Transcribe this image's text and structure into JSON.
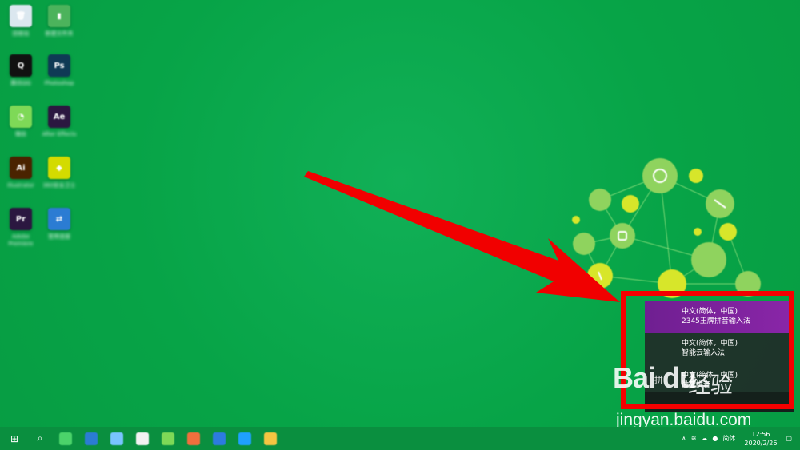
{
  "desktop": {
    "background": "#0aa64a",
    "icons": [
      {
        "name": "Recycle Bin",
        "label": "回收站",
        "icon": "recycle-bin-icon",
        "color": "#dbe7ef",
        "glyph": "🗑"
      },
      {
        "name": "Folder",
        "label": "新建文件夹",
        "icon": "folder-icon",
        "color": "#4cb35c",
        "glyph": "▮"
      },
      {
        "name": "QQ",
        "label": "腾讯QQ",
        "icon": "qq-icon",
        "color": "#111111",
        "glyph": "Q"
      },
      {
        "name": "Photoshop",
        "label": "Photoshop",
        "icon": "photoshop-icon",
        "color": "#0f3a55",
        "glyph": "Ps"
      },
      {
        "name": "WeChat",
        "label": "微信",
        "icon": "wechat-icon",
        "color": "#7ed957",
        "glyph": "◔"
      },
      {
        "name": "After Effects",
        "label": "After Effects",
        "icon": "after-effects-icon",
        "color": "#2b1740",
        "glyph": "Ae"
      },
      {
        "name": "Illustrator",
        "label": "Illustrator",
        "icon": "illustrator-icon",
        "color": "#4a2300",
        "glyph": "Ai"
      },
      {
        "name": "Security Guard",
        "label": "360安全卫士",
        "icon": "security-icon",
        "color": "#d3db00",
        "glyph": "◆"
      },
      {
        "name": "Premiere",
        "label": "Adobe Premiere",
        "icon": "premiere-icon",
        "color": "#2b1740",
        "glyph": "Pr"
      },
      {
        "name": "Network",
        "label": "宽带连接",
        "icon": "network-icon",
        "color": "#2b7cd3",
        "glyph": "⇄"
      }
    ]
  },
  "input_menu": {
    "items": [
      {
        "lang": "中文(简体，中国)",
        "method": "2345王牌拼音输入法",
        "mark": ""
      },
      {
        "lang": "中文(简体，中国)",
        "method": "智能云输入法",
        "mark": ""
      },
      {
        "lang": "中文(简体，中国)",
        "method": "微软拼音",
        "mark": "拼"
      }
    ]
  },
  "watermark": {
    "brand": "Bai du",
    "jy": "经验",
    "url": "jingyan.baidu.com"
  },
  "taskbar": {
    "start_icon": "start-icon",
    "search_icon": "search-icon",
    "apps": [
      {
        "name": "apps",
        "color": "#4bd36a"
      },
      {
        "name": "edge",
        "color": "#2b7cd3"
      },
      {
        "name": "network",
        "color": "#79c4ff"
      },
      {
        "name": "mail",
        "color": "#f2f2f2"
      },
      {
        "name": "wechat",
        "color": "#7ed957"
      },
      {
        "name": "photo",
        "color": "#f06f3d"
      },
      {
        "name": "photoshop",
        "color": "#2d7be0"
      },
      {
        "name": "explorer",
        "color": "#1fa0ff"
      },
      {
        "name": "folder",
        "color": "#f4c542"
      }
    ],
    "tray": {
      "ime": "简体",
      "time": "12:56",
      "date": "2020/2/26"
    }
  }
}
